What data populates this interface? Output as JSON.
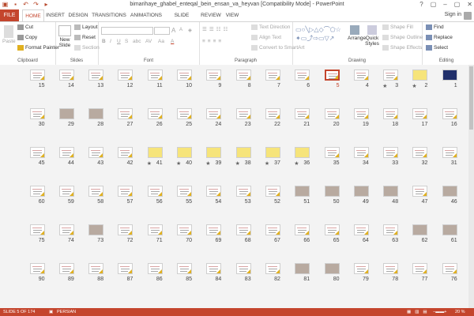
{
  "window": {
    "title": "bimarihaye_ghabel_enteqal_bein_ensan_va_heyvan [Compatibility Mode] - PowerPoint",
    "controls": [
      "?",
      "▢",
      "–",
      "▢",
      "✕"
    ],
    "signin": "Sign in"
  },
  "tabs": [
    "FILE",
    "HOME",
    "INSERT",
    "DESIGN",
    "TRANSITIONS",
    "ANIMATIONS",
    "SLIDE SHOW",
    "REVIEW",
    "VIEW"
  ],
  "ribbon": {
    "clipboard": {
      "paste": "Paste",
      "cut": "Cut",
      "copy": "Copy",
      "format_painter": "Format Painter",
      "label": "Clipboard"
    },
    "slides": {
      "new_slide": "New Slide",
      "layout": "Layout",
      "reset": "Reset",
      "section": "Section",
      "label": "Slides"
    },
    "font": {
      "label": "Font",
      "size_up": "A",
      "size_down": "A",
      "bold": "B",
      "italic": "I",
      "underline": "U",
      "strike": "S",
      "shadow": "abc",
      "spacing": "AV",
      "case": "Aa",
      "color": "A"
    },
    "paragraph": {
      "text_direction": "Text Direction",
      "align_text": "Align Text",
      "convert_smartart": "Convert to SmartArt",
      "label": "Paragraph"
    },
    "drawing": {
      "arrange": "Arrange",
      "quick_styles": "Quick Styles",
      "shape_fill": "Shape Fill",
      "shape_outline": "Shape Outline",
      "shape_effects": "Shape Effects",
      "label": "Drawing"
    },
    "editing": {
      "find": "Find",
      "replace": "Replace",
      "select": "Select",
      "label": "Editing"
    }
  },
  "slides": [
    {
      "n": "1",
      "kind": "dark"
    },
    {
      "n": "2",
      "kind": "map",
      "star": true
    },
    {
      "n": "3",
      "kind": "text",
      "star": true
    },
    {
      "n": "4",
      "kind": "text"
    },
    {
      "n": "5",
      "kind": "text",
      "selected": true
    },
    {
      "n": "6",
      "kind": "text"
    },
    {
      "n": "7",
      "kind": "text"
    },
    {
      "n": "8",
      "kind": "text"
    },
    {
      "n": "9",
      "kind": "text"
    },
    {
      "n": "10",
      "kind": "text"
    },
    {
      "n": "11",
      "kind": "text"
    },
    {
      "n": "12",
      "kind": "text"
    },
    {
      "n": "13",
      "kind": "text"
    },
    {
      "n": "14",
      "kind": "text"
    },
    {
      "n": "15",
      "kind": "text"
    },
    {
      "n": "16",
      "kind": "text"
    },
    {
      "n": "17",
      "kind": "text"
    },
    {
      "n": "18",
      "kind": "text"
    },
    {
      "n": "19",
      "kind": "text"
    },
    {
      "n": "20",
      "kind": "text"
    },
    {
      "n": "21",
      "kind": "text"
    },
    {
      "n": "22",
      "kind": "text"
    },
    {
      "n": "23",
      "kind": "text"
    },
    {
      "n": "24",
      "kind": "text"
    },
    {
      "n": "25",
      "kind": "text"
    },
    {
      "n": "26",
      "kind": "text"
    },
    {
      "n": "27",
      "kind": "text"
    },
    {
      "n": "28",
      "kind": "photo"
    },
    {
      "n": "29",
      "kind": "photo"
    },
    {
      "n": "30",
      "kind": "text"
    },
    {
      "n": "31",
      "kind": "text"
    },
    {
      "n": "32",
      "kind": "text"
    },
    {
      "n": "33",
      "kind": "text"
    },
    {
      "n": "34",
      "kind": "text"
    },
    {
      "n": "35",
      "kind": "text"
    },
    {
      "n": "36",
      "kind": "map",
      "star": true
    },
    {
      "n": "37",
      "kind": "map",
      "star": true
    },
    {
      "n": "38",
      "kind": "map",
      "star": true
    },
    {
      "n": "39",
      "kind": "map",
      "star": true
    },
    {
      "n": "40",
      "kind": "map",
      "star": true
    },
    {
      "n": "41",
      "kind": "map",
      "star": true
    },
    {
      "n": "42",
      "kind": "text"
    },
    {
      "n": "43",
      "kind": "text"
    },
    {
      "n": "44",
      "kind": "text"
    },
    {
      "n": "45",
      "kind": "text"
    },
    {
      "n": "46",
      "kind": "photo"
    },
    {
      "n": "47",
      "kind": "text"
    },
    {
      "n": "48",
      "kind": "photo"
    },
    {
      "n": "49",
      "kind": "photo"
    },
    {
      "n": "50",
      "kind": "photo"
    },
    {
      "n": "51",
      "kind": "photo"
    },
    {
      "n": "52",
      "kind": "text"
    },
    {
      "n": "53",
      "kind": "text"
    },
    {
      "n": "54",
      "kind": "text"
    },
    {
      "n": "55",
      "kind": "text"
    },
    {
      "n": "56",
      "kind": "text"
    },
    {
      "n": "57",
      "kind": "text"
    },
    {
      "n": "58",
      "kind": "text"
    },
    {
      "n": "59",
      "kind": "text"
    },
    {
      "n": "60",
      "kind": "text"
    },
    {
      "n": "61",
      "kind": "photo"
    },
    {
      "n": "62",
      "kind": "photo"
    },
    {
      "n": "63",
      "kind": "text"
    },
    {
      "n": "64",
      "kind": "text"
    },
    {
      "n": "65",
      "kind": "text"
    },
    {
      "n": "66",
      "kind": "text"
    },
    {
      "n": "67",
      "kind": "text"
    },
    {
      "n": "68",
      "kind": "text"
    },
    {
      "n": "69",
      "kind": "text"
    },
    {
      "n": "70",
      "kind": "text"
    },
    {
      "n": "71",
      "kind": "text"
    },
    {
      "n": "72",
      "kind": "text"
    },
    {
      "n": "73",
      "kind": "photo"
    },
    {
      "n": "74",
      "kind": "text"
    },
    {
      "n": "75",
      "kind": "text"
    },
    {
      "n": "76",
      "kind": "text"
    },
    {
      "n": "77",
      "kind": "text"
    },
    {
      "n": "78",
      "kind": "text"
    },
    {
      "n": "79",
      "kind": "text"
    },
    {
      "n": "80",
      "kind": "photo"
    },
    {
      "n": "81",
      "kind": "photo"
    },
    {
      "n": "82",
      "kind": "text"
    },
    {
      "n": "83",
      "kind": "text"
    },
    {
      "n": "84",
      "kind": "text"
    },
    {
      "n": "85",
      "kind": "text"
    },
    {
      "n": "86",
      "kind": "text"
    },
    {
      "n": "87",
      "kind": "text"
    },
    {
      "n": "88",
      "kind": "text"
    },
    {
      "n": "89",
      "kind": "text"
    },
    {
      "n": "90",
      "kind": "text"
    }
  ],
  "status": {
    "slide": "SLIDE 5 OF 174",
    "language": "PERSIAN",
    "zoom": "20 %"
  },
  "colors": {
    "accent": "#c4452d",
    "map": "#f6e47a"
  }
}
